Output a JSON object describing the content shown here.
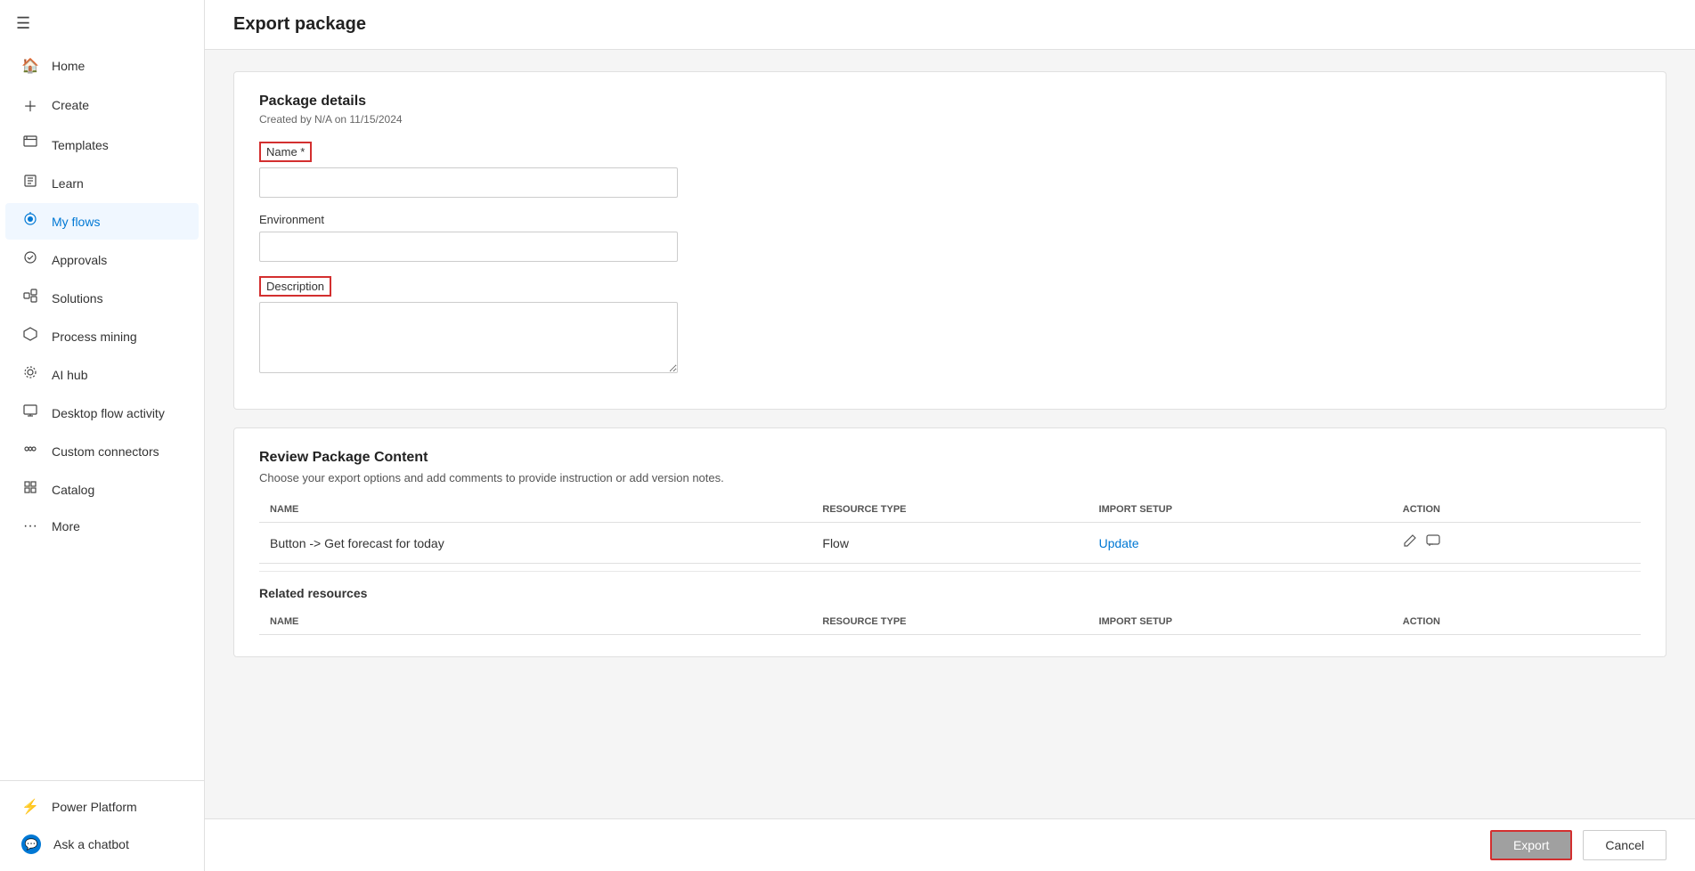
{
  "sidebar": {
    "hamburger": "☰",
    "items": [
      {
        "id": "home",
        "label": "Home",
        "icon": "🏠"
      },
      {
        "id": "create",
        "label": "Create",
        "icon": "+"
      },
      {
        "id": "templates",
        "label": "Templates",
        "icon": "📄"
      },
      {
        "id": "learn",
        "label": "Learn",
        "icon": "📖"
      },
      {
        "id": "my-flows",
        "label": "My flows",
        "icon": "💧",
        "active": true
      },
      {
        "id": "approvals",
        "label": "Approvals",
        "icon": "✅"
      },
      {
        "id": "solutions",
        "label": "Solutions",
        "icon": "🧩"
      },
      {
        "id": "process-mining",
        "label": "Process mining",
        "icon": "⬡"
      },
      {
        "id": "ai-hub",
        "label": "AI hub",
        "icon": "🤖"
      },
      {
        "id": "desktop-flow-activity",
        "label": "Desktop flow activity",
        "icon": "🖥"
      },
      {
        "id": "custom-connectors",
        "label": "Custom connectors",
        "icon": "🔌"
      },
      {
        "id": "catalog",
        "label": "Catalog",
        "icon": "📋"
      },
      {
        "id": "more",
        "label": "More",
        "icon": "···"
      }
    ],
    "bottom_items": [
      {
        "id": "power-platform",
        "label": "Power Platform",
        "icon": "⚡"
      },
      {
        "id": "ask-chatbot",
        "label": "Ask a chatbot",
        "icon": "💬"
      }
    ]
  },
  "page": {
    "title": "Export package"
  },
  "package_details": {
    "heading": "Package details",
    "subtitle": "Created by N/A on 11/15/2024",
    "name_label": "Name *",
    "name_placeholder": "",
    "environment_label": "Environment",
    "environment_placeholder": "",
    "description_label": "Description",
    "description_placeholder": ""
  },
  "review_package": {
    "heading": "Review Package Content",
    "description": "Choose your export options and add comments to provide instruction or add version notes.",
    "columns": {
      "name": "NAME",
      "resource_type": "RESOURCE TYPE",
      "import_setup": "IMPORT SETUP",
      "action": "ACTION"
    },
    "rows": [
      {
        "name": "Button -> Get forecast for today",
        "resource_type": "Flow",
        "import_setup": "Update",
        "action_icons": [
          "edit",
          "comment"
        ]
      }
    ]
  },
  "related_resources": {
    "label": "Related resources",
    "columns": {
      "name": "NAME",
      "resource_type": "RESOURCE TYPE",
      "import_setup": "IMPORT SETUP",
      "action": "ACTION"
    }
  },
  "footer": {
    "export_label": "Export",
    "cancel_label": "Cancel"
  }
}
